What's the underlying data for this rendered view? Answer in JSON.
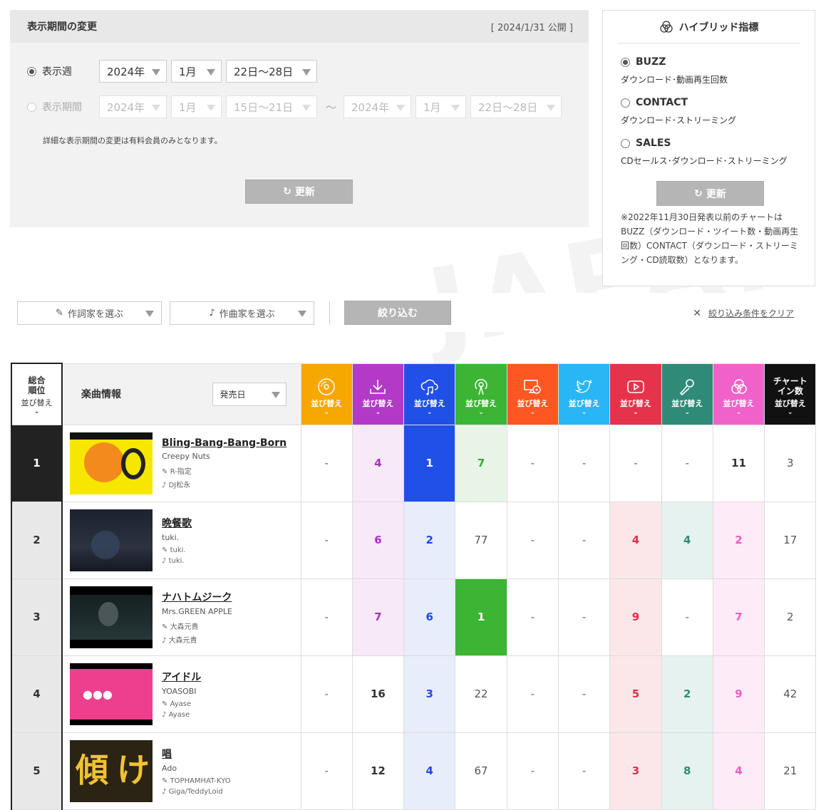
{
  "period": {
    "title": "表示期間の変更",
    "published": "[ 2024/1/31 公開 ]",
    "week_label": "表示週",
    "week": {
      "year": "2024年",
      "month": "1月",
      "days": "22日〜28日"
    },
    "range_label": "表示期間",
    "range_from": {
      "year": "2024年",
      "month": "1月",
      "days": "15日〜21日"
    },
    "tilde": "〜",
    "range_to": {
      "year": "2024年",
      "month": "1月",
      "days": "22日〜28日"
    },
    "note": "詳細な表示期間の変更は有料会員のみとなります。",
    "update": "更新"
  },
  "hybrid": {
    "title": "ハイブリッド指標",
    "options": [
      {
        "name": "BUZZ",
        "desc": "ダウンロード･動画再生回数",
        "selected": true
      },
      {
        "name": "CONTACT",
        "desc": "ダウンロード･ストリーミング",
        "selected": false
      },
      {
        "name": "SALES",
        "desc": "CDセールス･ダウンロード･ストリーミング",
        "selected": false
      }
    ],
    "update": "更新",
    "note": "※2022年11月30日発表以前のチャートはBUZZ（ダウンロード・ツイート数・動画再生回数）CONTACT（ダウンロード・ストリーミング・CD読取数）となります。"
  },
  "filter": {
    "lyricist": "作詞家を選ぶ",
    "composer": "作曲家を選ぶ",
    "apply": "絞り込む",
    "clear": "絞り込み条件をクリア"
  },
  "table": {
    "rank_header": "総合\n順位",
    "sort": "並び替え",
    "song_header": "楽曲情報",
    "release": "発売日",
    "chartin_header": "チャート\nイン数",
    "metrics": [
      {
        "icon": "cd-icon",
        "color": "#f6a800"
      },
      {
        "icon": "download-icon",
        "color": "#b33ac7"
      },
      {
        "icon": "streaming-icon",
        "color": "#2050e8"
      },
      {
        "icon": "radio-icon",
        "color": "#3db534"
      },
      {
        "icon": "lookup-icon",
        "color": "#ff5722"
      },
      {
        "icon": "twitter-icon",
        "color": "#29b6f6"
      },
      {
        "icon": "youtube-icon",
        "color": "#e5334b"
      },
      {
        "icon": "karaoke-icon",
        "color": "#2f8b78"
      },
      {
        "icon": "hybrid-icon",
        "color": "#f062c9"
      }
    ],
    "rows": [
      {
        "rank": "1",
        "title": "Bling-Bang-Bang-Born",
        "artist": "Creepy Nuts",
        "lyricist": "R-指定",
        "composer": "DJ松永",
        "values": [
          "-",
          "4",
          "1",
          "7",
          "-",
          "-",
          "-",
          "-",
          "11"
        ],
        "chartin": "3"
      },
      {
        "rank": "2",
        "title": "晩餐歌",
        "artist": "tuki.",
        "lyricist": "tuki.",
        "composer": "tuki.",
        "values": [
          "-",
          "6",
          "2",
          "77",
          "-",
          "-",
          "4",
          "4",
          "2"
        ],
        "chartin": "17"
      },
      {
        "rank": "3",
        "title": "ナハトムジーク",
        "artist": "Mrs.GREEN APPLE",
        "lyricist": "大森元貴",
        "composer": "大森元貴",
        "values": [
          "-",
          "7",
          "6",
          "1",
          "-",
          "-",
          "9",
          "-",
          "7"
        ],
        "chartin": "2"
      },
      {
        "rank": "4",
        "title": "アイドル",
        "artist": "YOASOBI",
        "lyricist": "Ayase",
        "composer": "Ayase",
        "values": [
          "-",
          "16",
          "3",
          "22",
          "-",
          "-",
          "5",
          "2",
          "9"
        ],
        "chartin": "42"
      },
      {
        "rank": "5",
        "title": "唱",
        "artist": "Ado",
        "lyricist": "TOPHAMHAT-KYO",
        "composer": "Giga/TeddyLoid",
        "values": [
          "-",
          "12",
          "4",
          "67",
          "-",
          "-",
          "3",
          "8",
          "4"
        ],
        "chartin": "21"
      }
    ]
  }
}
